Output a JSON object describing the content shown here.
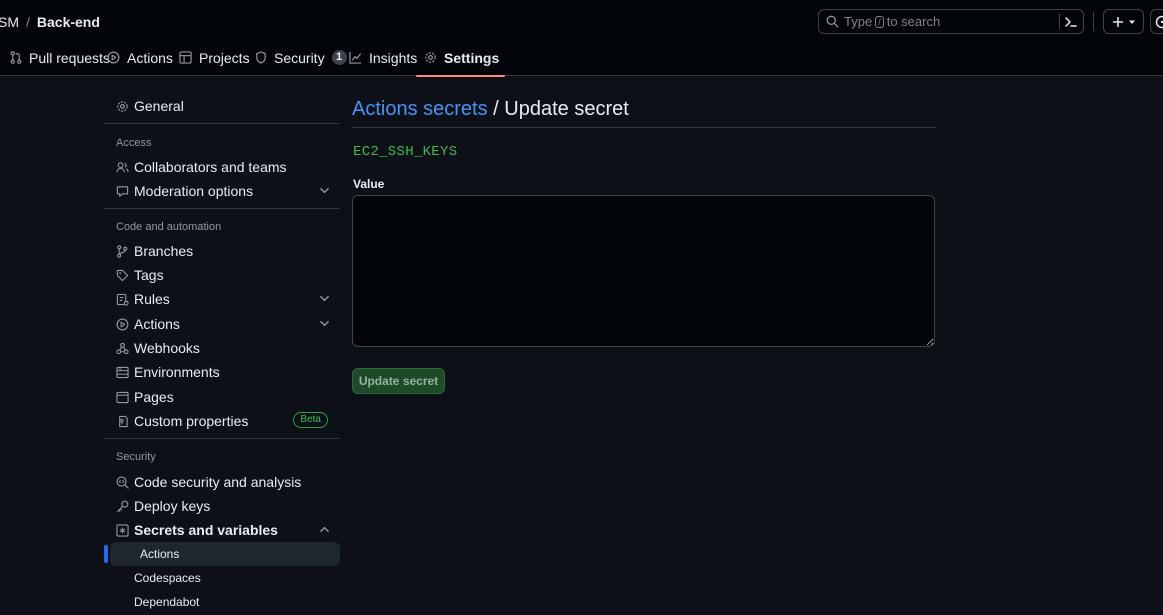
{
  "breadcrumb": {
    "owner": "SM",
    "separator": "/",
    "repo": "Back-end"
  },
  "search": {
    "prefix": "Type",
    "key": "/",
    "suffix": "to search"
  },
  "tabs": [
    {
      "label": "Pull requests",
      "icon": "pull-request-icon"
    },
    {
      "label": "Actions",
      "icon": "play-icon"
    },
    {
      "label": "Projects",
      "icon": "table-icon"
    },
    {
      "label": "Security",
      "icon": "shield-icon",
      "count": "1"
    },
    {
      "label": "Insights",
      "icon": "graph-icon"
    },
    {
      "label": "Settings",
      "icon": "gear-icon",
      "active": true
    }
  ],
  "sidebar": {
    "general": "General",
    "access_heading": "Access",
    "collaborators": "Collaborators and teams",
    "moderation": "Moderation options",
    "code_heading": "Code and automation",
    "branches": "Branches",
    "tags": "Tags",
    "rules": "Rules",
    "actions": "Actions",
    "webhooks": "Webhooks",
    "environments": "Environments",
    "pages": "Pages",
    "custom_properties": "Custom properties",
    "beta_badge": "Beta",
    "security_heading": "Security",
    "code_security": "Code security and analysis",
    "deploy_keys": "Deploy keys",
    "secrets": "Secrets and variables",
    "sub_actions": "Actions",
    "sub_codespaces": "Codespaces",
    "sub_dependabot": "Dependabot"
  },
  "main": {
    "title_link": "Actions secrets",
    "title_sep": " / ",
    "title_rest": "Update secret",
    "secret_name": "EC2_SSH_KEYS",
    "value_label": "Value",
    "value": "",
    "button": "Update secret"
  },
  "colors": {
    "background": "#0d1117",
    "link": "#4493f8",
    "secret_name": "#3fb950",
    "active_tab_underline": "#fd8c73",
    "active_nav_bar": "#1f6feb"
  }
}
